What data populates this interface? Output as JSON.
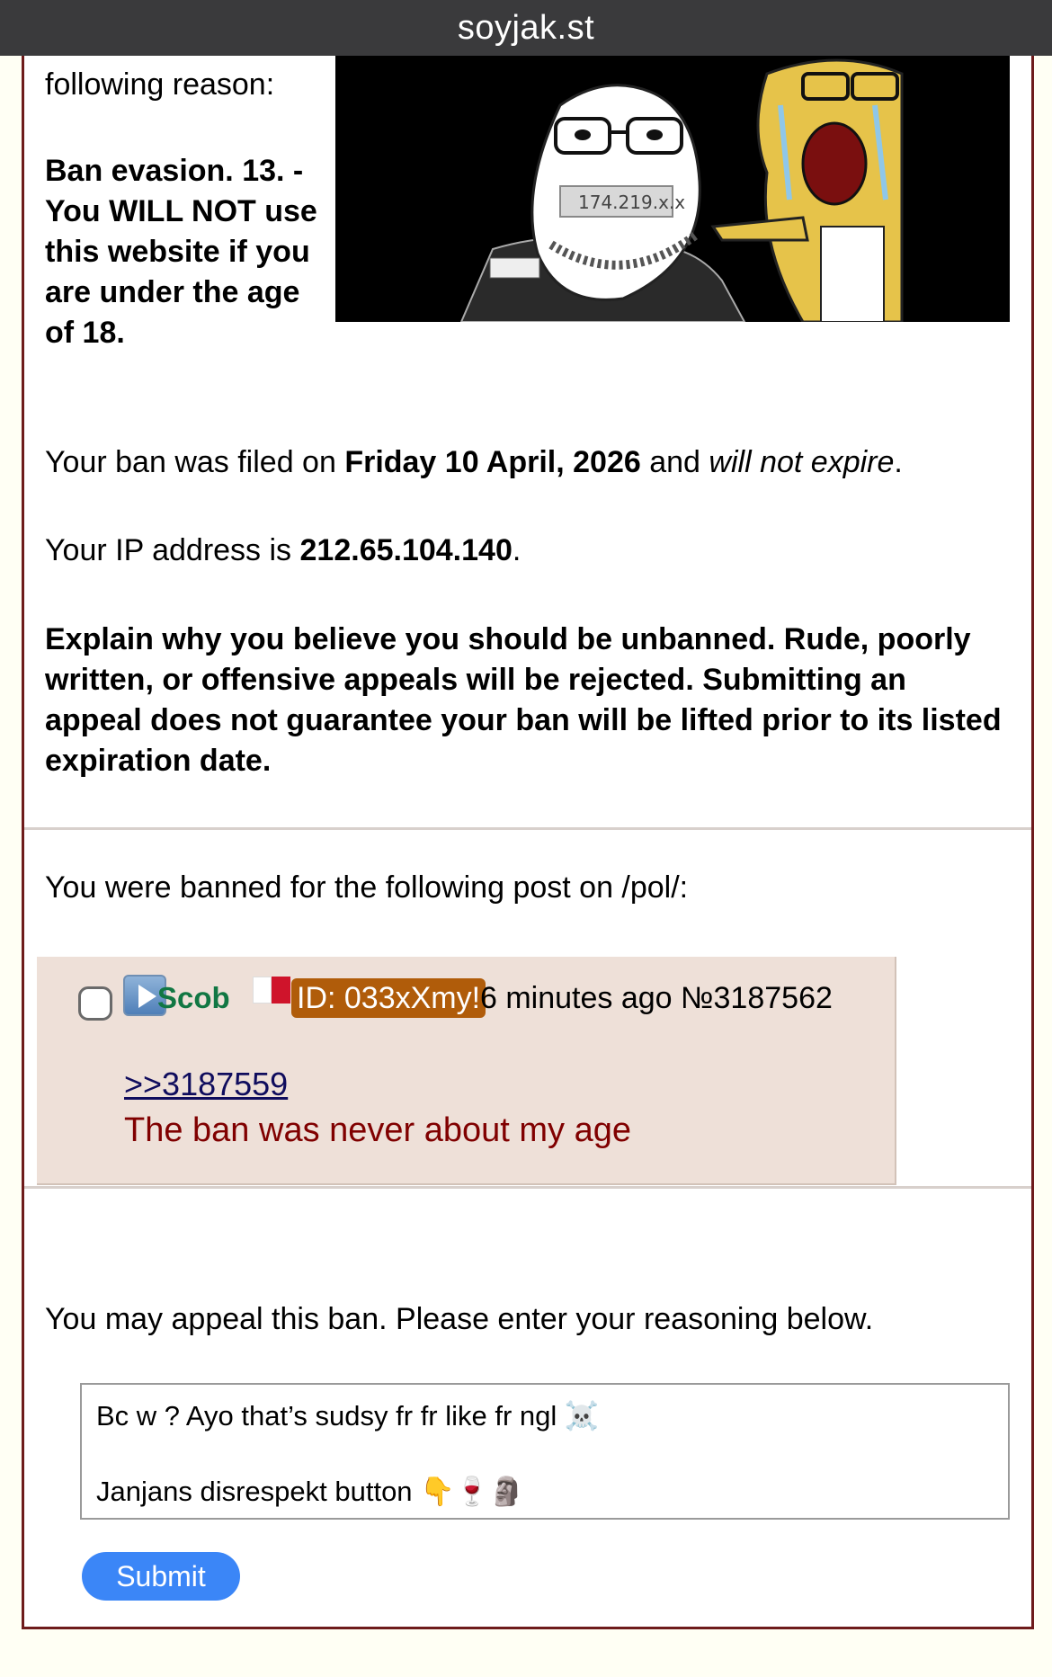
{
  "browser": {
    "domain": "soyjak.st"
  },
  "ban": {
    "reason_lead": "following reason:",
    "reason": "Ban evasion. 13. - You WILL NOT use this website if you are under the age of 18.",
    "filed_prefix": "Your ban was filed on ",
    "filed_date": "Friday 10 April, 2026",
    "filed_middle": " and ",
    "filed_expiry": "will not expire",
    "filed_suffix": ".",
    "ip_prefix": "Your IP address is ",
    "ip": "212.65.104.140",
    "ip_suffix": ".",
    "explain": "Explain why you believe you should be unbanned. Rude, poorly written, or offensive appeals will be rejected. Submitting an appeal does not guarantee your ban will be lifted prior to its listed expiration date.",
    "image_caption": "174.219.x.x"
  },
  "post_section": {
    "lead": "You were banned for the following post on /pol/:",
    "post": {
      "name": "Scob",
      "flag": "malta-flag-icon",
      "id_label": "ID: 033xXmy!",
      "time": "6 minutes ago",
      "number": "№3187562",
      "quote_link": ">>3187559",
      "body": "The ban was never about my age"
    }
  },
  "appeal": {
    "lead": "You may appeal this ban. Please enter your reasoning below.",
    "text": "Bc w ? Ayo that’s sudsy fr fr like fr ngl ☠️\n\nJanjans disrespekt button 👇🍷🗿",
    "submit_label": "Submit"
  },
  "colors": {
    "topbar": "#3a3a3c",
    "border": "#6e1b1b",
    "post_bg": "#eee0d8",
    "name": "#117743",
    "id_badge": "#b05c0a",
    "quote": "#0f0c5d",
    "body_text": "#800000",
    "submit": "#3b86f7"
  }
}
